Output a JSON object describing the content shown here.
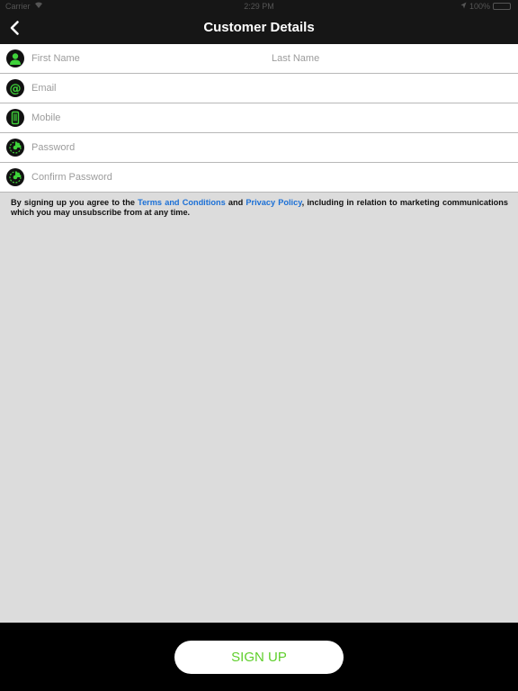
{
  "status_bar": {
    "carrier": "Carrier",
    "time": "2:29 PM",
    "battery_text": "100%",
    "battery_level": 1.0
  },
  "nav": {
    "title": "Customer Details",
    "back_icon": "chevron-left-icon"
  },
  "form": {
    "first_name_placeholder": "First Name",
    "last_name_placeholder": "Last Name",
    "email_placeholder": "Email",
    "mobile_placeholder": "Mobile",
    "password_placeholder": "Password",
    "confirm_password_placeholder": "Confirm Password"
  },
  "terms": {
    "prefix": "By signing up you agree to the ",
    "terms_link": "Terms and Conditions",
    "and": " and ",
    "privacy_link": "Privacy Policy",
    "suffix": ", including in relation to marketing communications which you may unsubscribe from at any time."
  },
  "footer": {
    "signup_label": "SIGN UP"
  },
  "colors": {
    "accent_green": "#5fcf2c",
    "icon_green": "#3fd23a",
    "link_blue": "#1a6fd6",
    "bar_dark": "#161616"
  }
}
